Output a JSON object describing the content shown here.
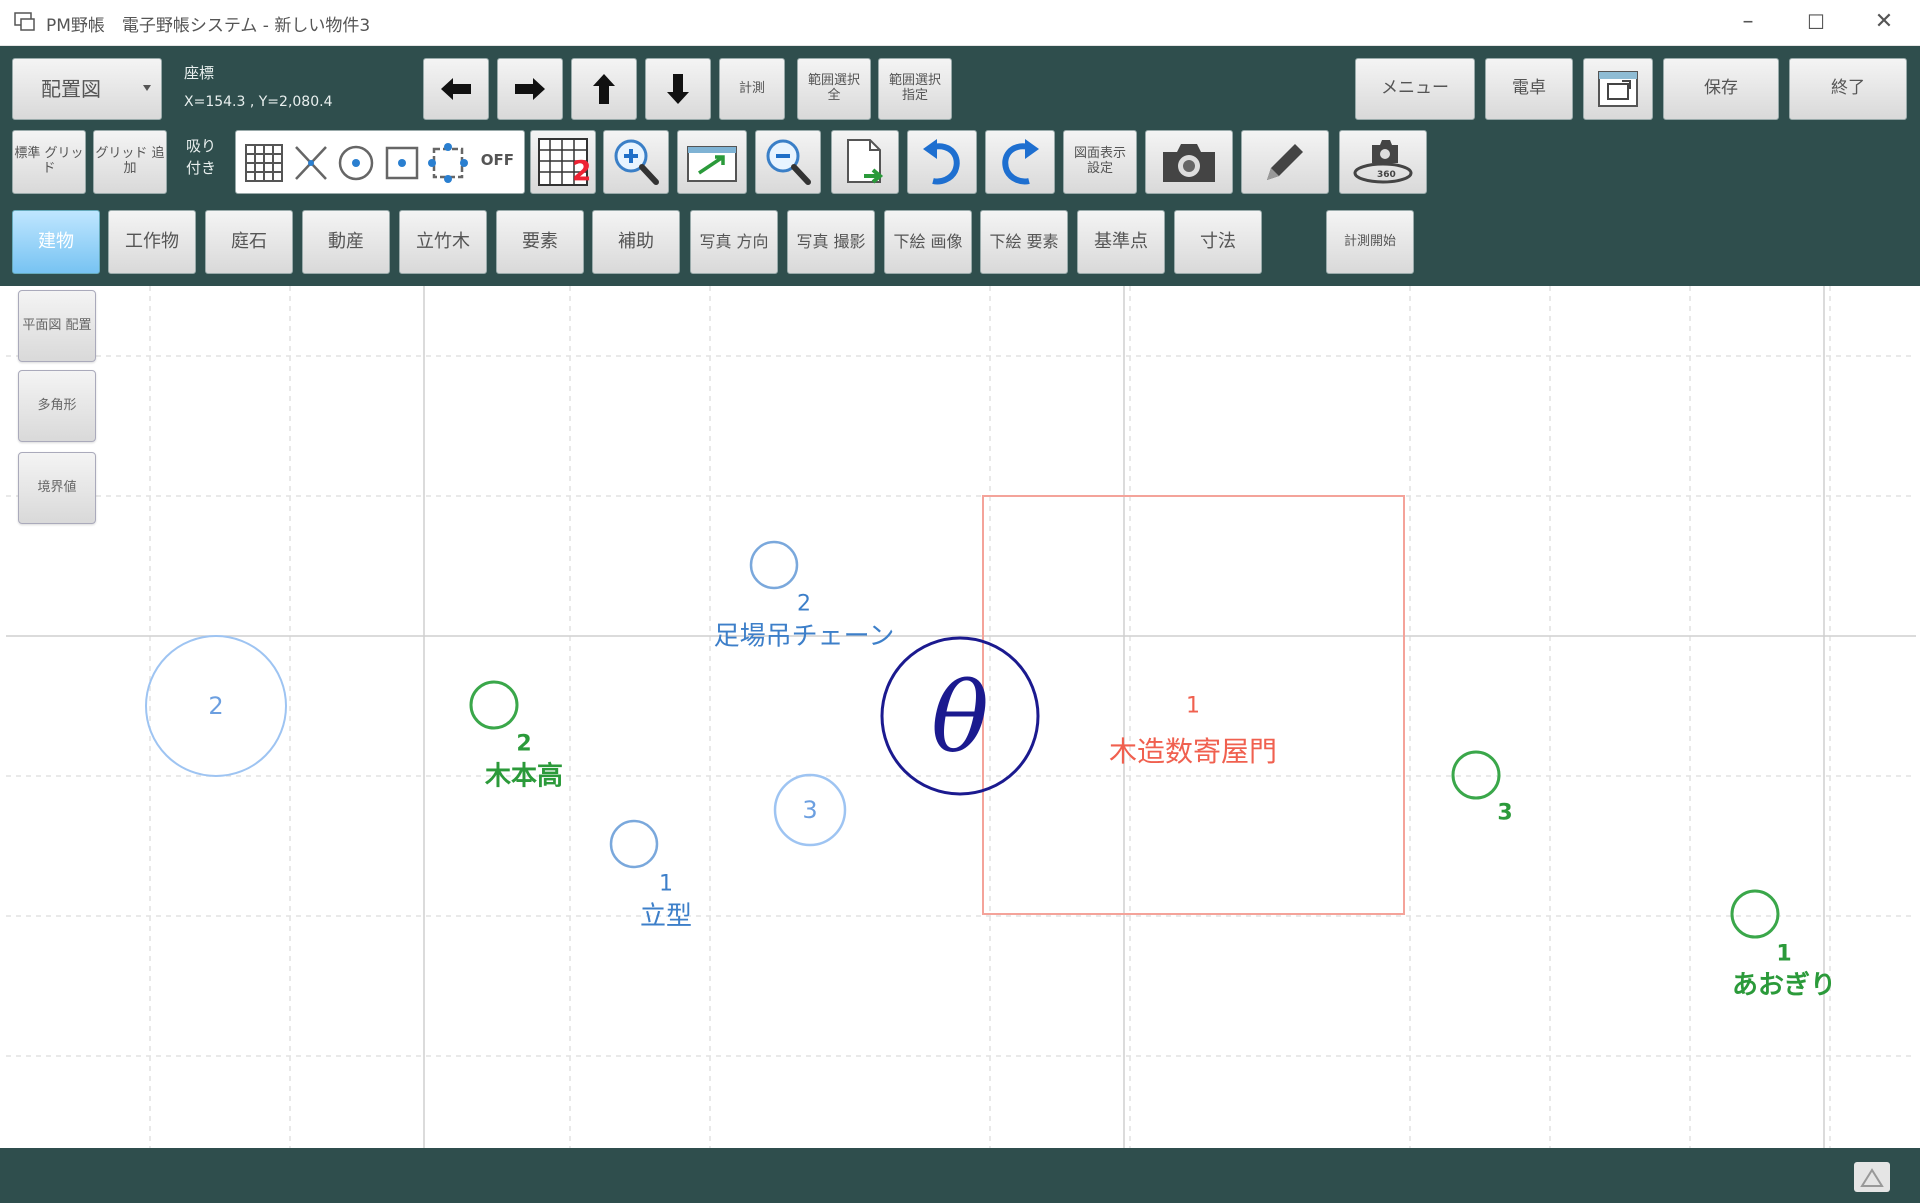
{
  "window": {
    "title": "PM野帳　電子野帳システム - 新しい物件3",
    "minimize": "–",
    "maximize": "☐",
    "close": "✕"
  },
  "toolbar": {
    "mode_select": "配置図",
    "coord_title": "座標",
    "coord_value": "X=154.3 , Y=2,080.4",
    "snap_label": "吸り付き",
    "snap_off": "OFF",
    "measure": "計測",
    "range_all": "範囲選択 全",
    "range_spec": "範囲選択 指定",
    "std_grid": "標準 グリッド",
    "grid_add": "グリッド 追加",
    "view_settings": "図面表示 設定",
    "menu": "メニュー",
    "calc": "電卓",
    "save": "保存",
    "exit": "終了",
    "measure_start": "計測開始"
  },
  "tabs": [
    {
      "label": "建物",
      "active": true
    },
    {
      "label": "工作物",
      "active": false
    },
    {
      "label": "庭石",
      "active": false
    },
    {
      "label": "動産",
      "active": false
    },
    {
      "label": "立竹木",
      "active": false
    },
    {
      "label": "要素",
      "active": false
    },
    {
      "label": "補助",
      "active": false
    },
    {
      "label": "写真 方向",
      "active": false
    },
    {
      "label": "写真 撮影",
      "active": false
    },
    {
      "label": "下絵 画像",
      "active": false
    },
    {
      "label": "下絵 要素",
      "active": false
    },
    {
      "label": "基準点",
      "active": false
    },
    {
      "label": "寸法",
      "active": false
    }
  ],
  "side_tools": [
    {
      "label": "平面図 配置"
    },
    {
      "label": "多角形"
    },
    {
      "label": "境界値"
    }
  ],
  "canvas": {
    "objects": [
      {
        "kind": "circle",
        "number": "2",
        "text": ""
      },
      {
        "kind": "circle",
        "number": "2",
        "text": "木本高"
      },
      {
        "kind": "circle",
        "number": "2",
        "text": "足場吊チェーン"
      },
      {
        "kind": "circle",
        "number": "1",
        "text": "立型"
      },
      {
        "kind": "circle",
        "number": "3",
        "text": ""
      },
      {
        "kind": "circle",
        "number": "3",
        "text": ""
      },
      {
        "kind": "circle",
        "number": "1",
        "text": "あおぎり"
      },
      {
        "kind": "rect",
        "number": "1",
        "text": "木造数寄屋門"
      },
      {
        "kind": "symbol",
        "number": "",
        "text": "θ"
      }
    ]
  },
  "colors": {
    "toolbar_bg": "#2f4e4d",
    "blue_label": "#3d7fc9",
    "green_label": "#2b9a3a",
    "red_label": "#f0604f",
    "theta": "#1b1a8f",
    "light_blue_circle": "#9ec4f2"
  }
}
